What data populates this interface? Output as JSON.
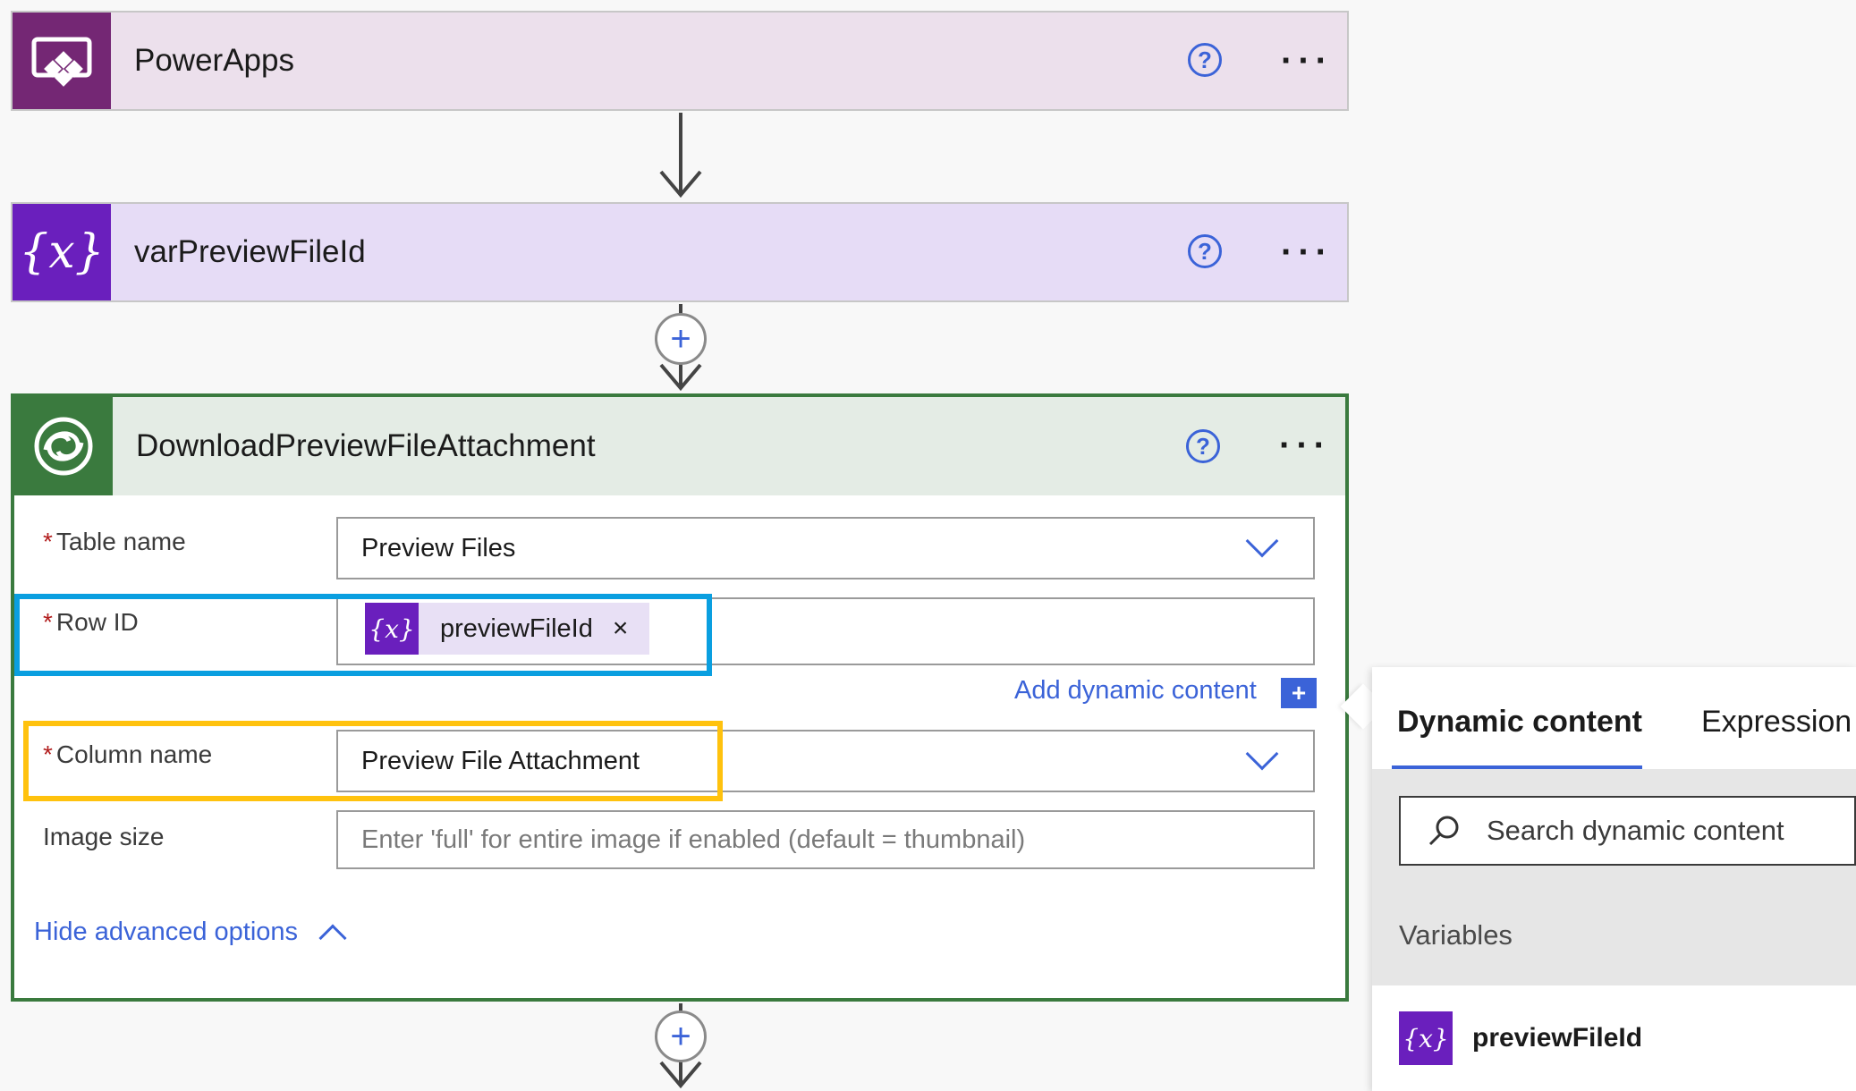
{
  "steps": [
    {
      "title": "PowerApps",
      "icon": "powerapps-icon"
    },
    {
      "title": "varPreviewFileId",
      "icon": "variable-icon"
    },
    {
      "title": "DownloadPreviewFileAttachment",
      "icon": "dataverse-icon"
    }
  ],
  "common": {
    "help_glyph": "?",
    "more_glyph": "···",
    "plus_glyph": "+",
    "required_mark": "*",
    "variable_glyph": "{x}",
    "close_glyph": "×"
  },
  "form": {
    "table_name": {
      "label": "Table name",
      "value": "Preview Files"
    },
    "row_id": {
      "label": "Row ID",
      "token": "previewFileId"
    },
    "add_dynamic": "Add dynamic content",
    "column_name": {
      "label": "Column name",
      "value": "Preview File Attachment"
    },
    "image_size": {
      "label": "Image size",
      "placeholder": "Enter 'full' for entire image if enabled (default = thumbnail)"
    },
    "hide_advanced": "Hide advanced options"
  },
  "panel": {
    "tabs": [
      "Dynamic content",
      "Expression"
    ],
    "active_tab": "Dynamic content",
    "search_placeholder": "Search dynamic content",
    "section": "Variables",
    "items": [
      "previewFileId"
    ]
  },
  "colors": {
    "powerapps": "#742774",
    "variable": "#6a1fbd",
    "dataverse": "#3a7a3e",
    "accent": "#3b63d8",
    "highlight_blue": "#0a9fe0",
    "highlight_yellow": "#ffc20e"
  }
}
